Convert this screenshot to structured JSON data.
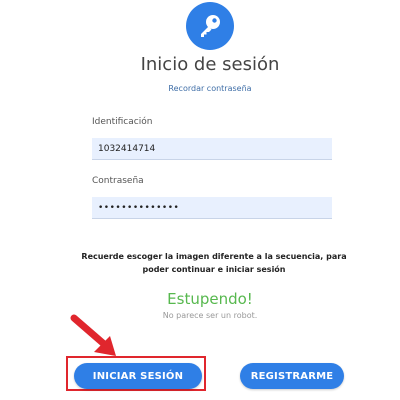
{
  "colors": {
    "accent": "#2f7fe6",
    "success": "#57b84e",
    "highlight": "#e0262d",
    "field_bg": "#e8f0fe"
  },
  "header": {
    "logo_icon": "key-icon",
    "title": "Inicio de sesión",
    "recover_link": "Recordar contraseña"
  },
  "form": {
    "id_label": "Identificación",
    "id_value": "1032414714",
    "password_label": "Contraseña",
    "password_value": "••••••••••••••"
  },
  "captcha": {
    "instruction": "Recuerde escoger la imagen diferente a la secuencia, para poder continuar e iniciar sesión",
    "success_text": "Estupendo!",
    "robot_text": "No parece ser un robot."
  },
  "actions": {
    "login_label": "INICIAR SESIÓN",
    "register_label": "REGISTRARME"
  },
  "annotation": {
    "arrow_icon": "red-arrow-icon"
  }
}
